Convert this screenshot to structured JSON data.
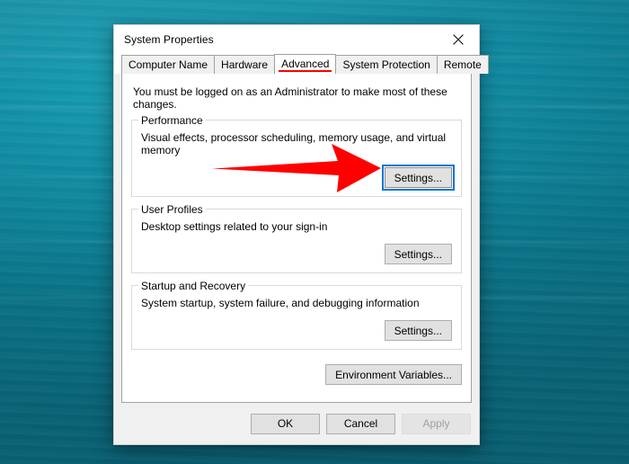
{
  "desktop": {
    "wallpaper_color": "#0c7e94",
    "wallpaper_name": "teal-water-wallpaper"
  },
  "dialog": {
    "title": "System Properties",
    "close_icon": "close-icon",
    "tabs": [
      {
        "label": "Computer Name",
        "active": false
      },
      {
        "label": "Hardware",
        "active": false
      },
      {
        "label": "Advanced",
        "active": true
      },
      {
        "label": "System Protection",
        "active": false
      },
      {
        "label": "Remote",
        "active": false
      }
    ],
    "admin_note": "You must be logged on as an Administrator to make most of these changes.",
    "groups": [
      {
        "legend": "Performance",
        "description": "Visual effects, processor scheduling, memory usage, and virtual memory",
        "button_label": "Settings...",
        "button_focused": true
      },
      {
        "legend": "User Profiles",
        "description": "Desktop settings related to your sign-in",
        "button_label": "Settings...",
        "button_focused": false
      },
      {
        "legend": "Startup and Recovery",
        "description": "System startup, system failure, and debugging information",
        "button_label": "Settings...",
        "button_focused": false
      }
    ],
    "environment_variables_label": "Environment Variables...",
    "footer": {
      "ok_label": "OK",
      "cancel_label": "Cancel",
      "apply_label": "Apply",
      "apply_disabled": true
    }
  },
  "annotation": {
    "arrow_color": "#fe0000",
    "tab_underline_color": "#fe0000",
    "focus_outline_color": "#0a76d2"
  }
}
